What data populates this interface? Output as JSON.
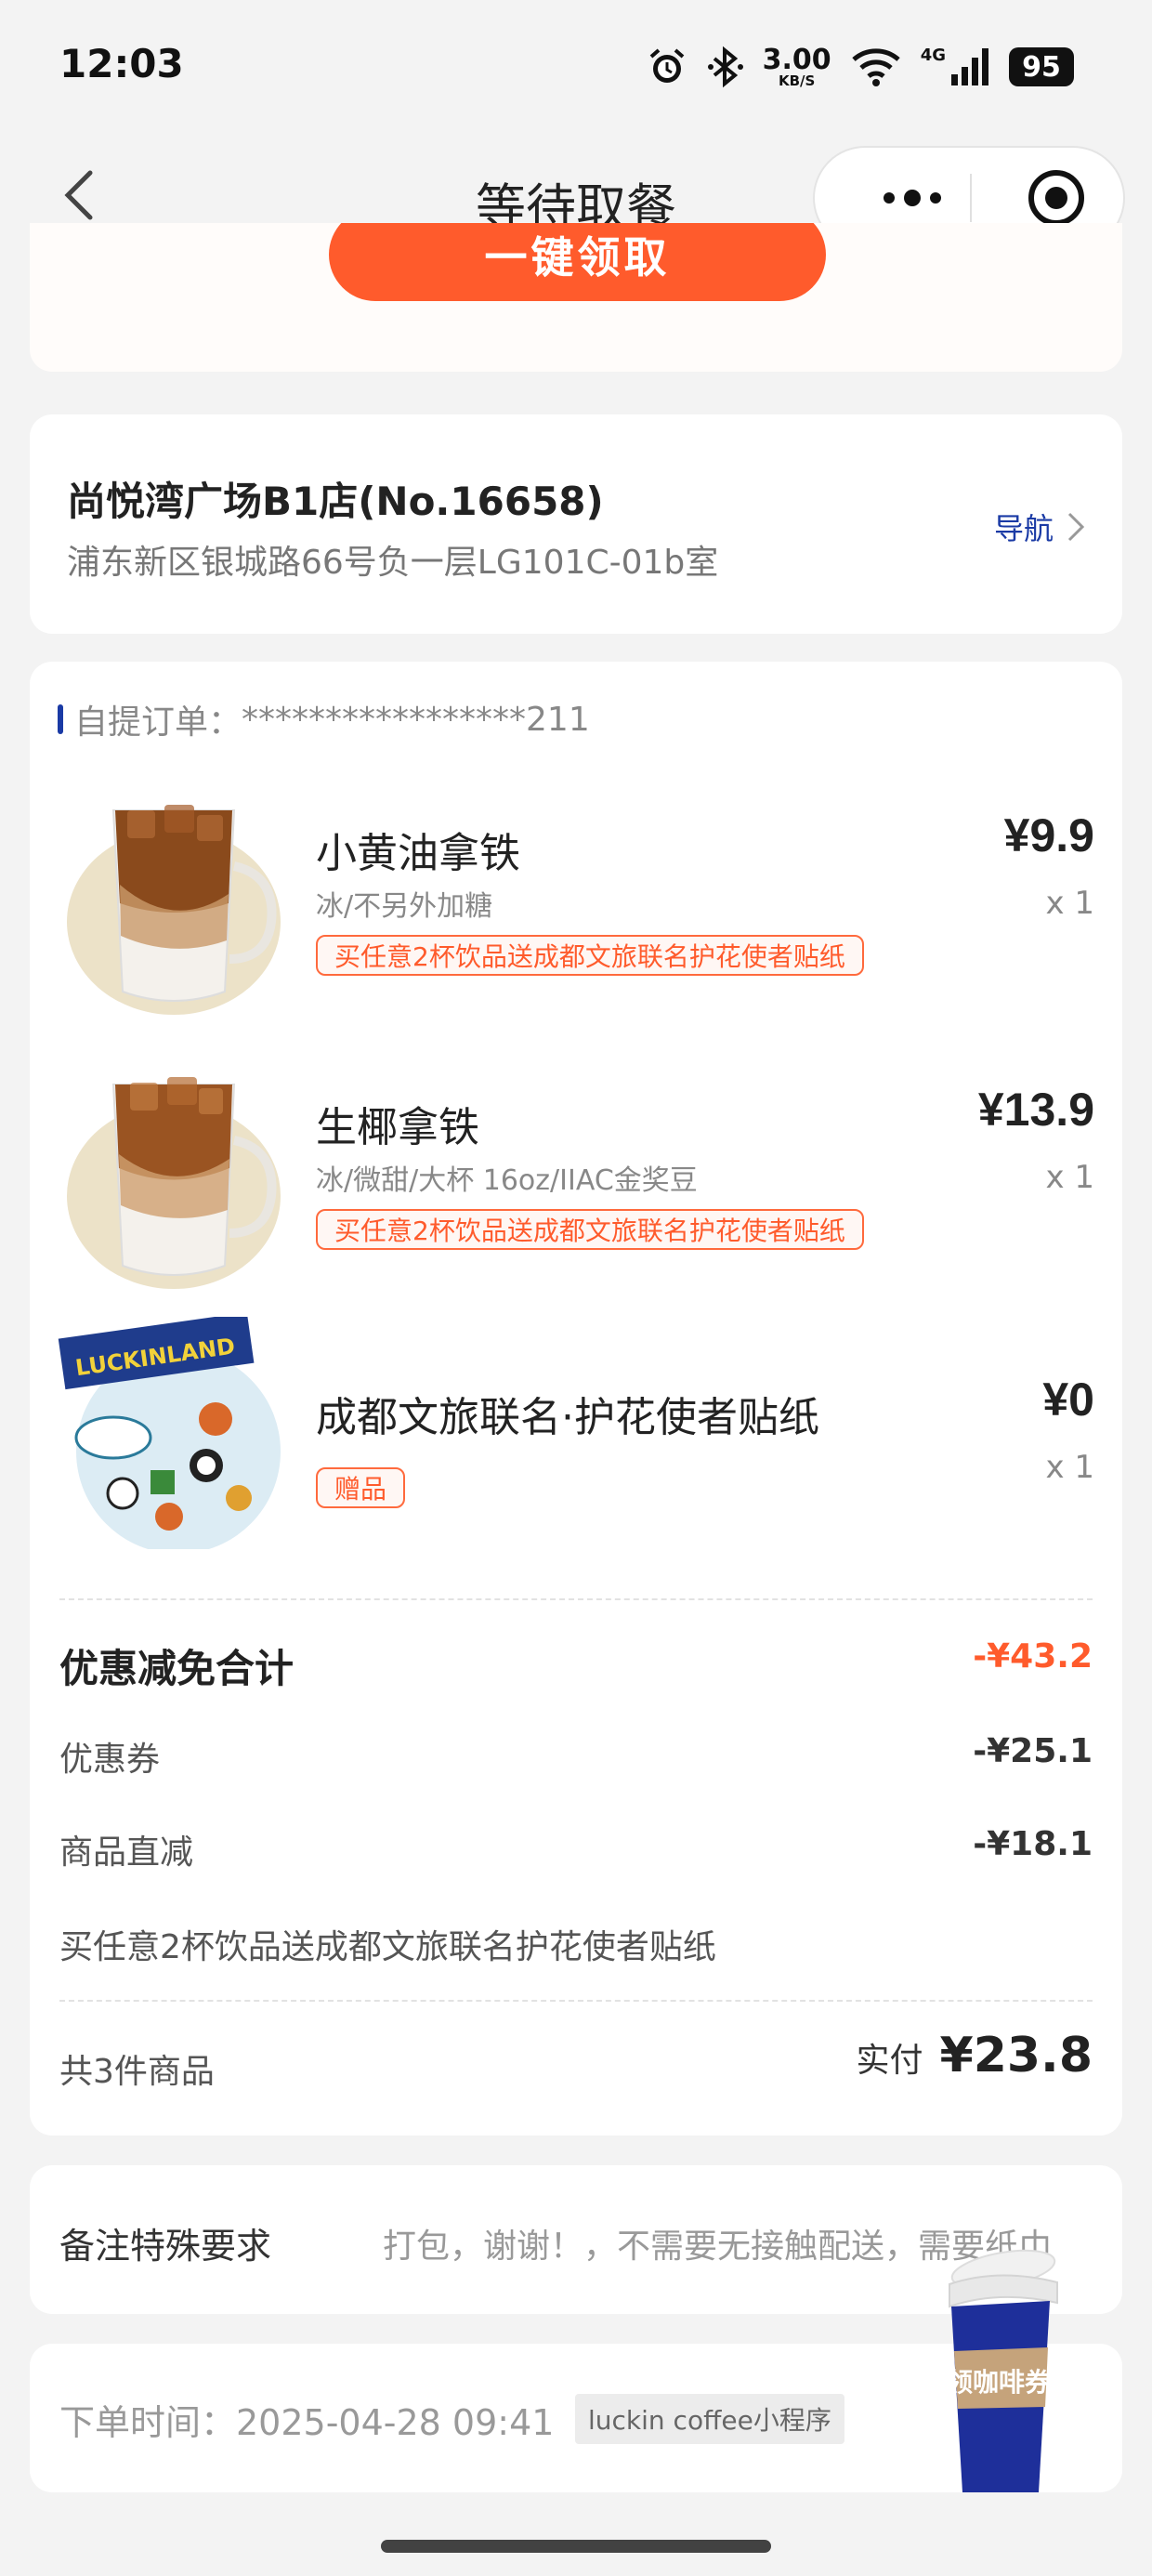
{
  "status_bar": {
    "time": "12:03",
    "net_speed_value": "3.00",
    "net_speed_unit": "KB/S",
    "network_type": "4G",
    "battery": "95"
  },
  "nav": {
    "title": "等待取餐"
  },
  "promo": {
    "claim_button": "一键领取"
  },
  "store": {
    "name": "尚悦湾广场B1店(No.16658)",
    "address": "浦东新区银城路66号负一层LG101C-01b室",
    "nav_label": "导航"
  },
  "order": {
    "label": "自提订单：",
    "number_masked": "*****************211",
    "items": [
      {
        "name": "小黄油拿铁",
        "spec": "冰/不另外加糖",
        "tag": "买任意2杯饮品送成都文旅联名护花使者贴纸",
        "price": "¥9.9",
        "qty": "x 1"
      },
      {
        "name": "生椰拿铁",
        "spec": "冰/微甜/大杯 16oz/IIAC金奖豆",
        "tag": "买任意2杯饮品送成都文旅联名护花使者贴纸",
        "price": "¥13.9",
        "qty": "x 1"
      },
      {
        "name": "成都文旅联名·护花使者贴纸",
        "spec": "",
        "tag": "赠品",
        "price": "¥0",
        "qty": "x 1"
      }
    ],
    "sticker_brand": "LUCKINLAND",
    "discount_title": "优惠减免合计",
    "discount_total": "-¥43.2",
    "coupon_label": "优惠券",
    "coupon_value": "-¥25.1",
    "direct_label": "商品直减",
    "direct_value": "-¥18.1",
    "promo_note": "买任意2杯饮品送成都文旅联名护花使者贴纸",
    "count_label": "共3件商品",
    "paid_label": "实付",
    "paid_value": "¥23.8"
  },
  "remark": {
    "label": "备注特殊要求",
    "value": "打包，谢谢！，不需要无接触配送，需要纸巾"
  },
  "meta": {
    "order_time": "下单时间：2025-04-28 09:41",
    "channel": "luckin coffee小程序"
  },
  "floating": {
    "coupon_label": "领咖啡券"
  },
  "colors": {
    "accent_orange": "#ff5b2c",
    "brand_blue": "#1a3aa5"
  }
}
